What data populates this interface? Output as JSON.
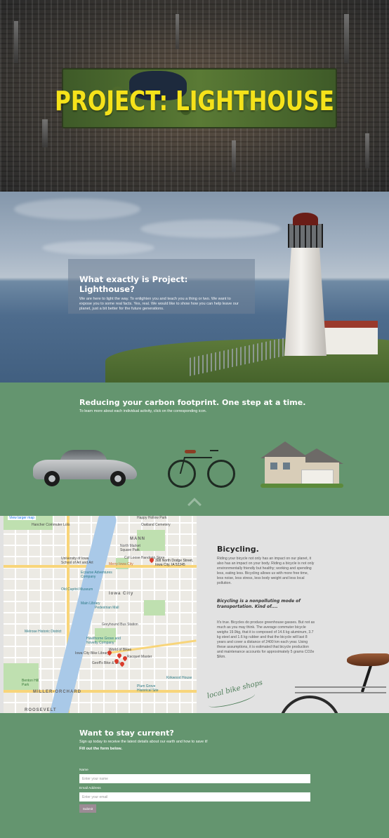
{
  "hero": {
    "title": "PROJECT: LIGHTHOUSE"
  },
  "intro": {
    "heading": "What exactly is Project: Lighthouse?",
    "text": "We are here to light the way. To enlighten you and teach you a thing or two. We want to expose you to some real facts. Yes, real. We would like to show how you can help leave our planet, just a bit better for the future generations."
  },
  "carbon": {
    "heading": "Reducing your carbon footprint. One step at a time.",
    "subtext": "To learn more about each individual activity, click on the corresponding icon.",
    "activities": [
      {
        "name": "car"
      },
      {
        "name": "bicycle"
      },
      {
        "name": "house"
      }
    ]
  },
  "map": {
    "view_link": "View larger map",
    "address": "308 North Dodge Street, Iowa City, IA 52245",
    "labels": {
      "happy_hollow": "Happy Hollow Park",
      "oakland": "Oakland Cemetery",
      "hancher": "Hancher Commuter Lots",
      "mann": "MANN",
      "north_market": "North Market Square Park",
      "col_loose": "Col Loose Handgrip Store",
      "merry_iowa": "Merry Iowa City",
      "univ_iowa": "University of Iowa School of Art and Art",
      "ecourse": "Ecourse Adventures Company",
      "old_capitol": "Old Capitol Museum",
      "iowa_city": "Iowa City",
      "main_library": "Main Library",
      "ped_mall": "Pedestrian Mall",
      "melrose": "Melrose Historic District",
      "greyhound": "Greyhound Bus Station",
      "hawthorne": "Hawthorne Grove and Novelty Company",
      "bike_library": "Iowa City Bike Library",
      "world_bikes": "World of Bikes",
      "racquet": "Racquet Master",
      "geoff": "Geoff's Bike & Ski",
      "kirkwood_house": "Kirkwood House",
      "plum_grove": "Plum Grove Historical Site",
      "miller_orchard": "MILLER-ORCHARD",
      "roosevelt": "ROOSEVELT",
      "benton_hill": "Benton Hill Park"
    }
  },
  "bicycling": {
    "heading": "Bicycling.",
    "paragraph1": "Riding your bicycle not only has an impact on our planet, it also has an impact on your body. Riding a bicycle is not only environmentally friendly but healthy; working and spending less, eating less. Bicycling allows us with more free time, less noise, less stress, less body weight and less local pollution.",
    "quote": "Bicycling is a nonpolluting mode of transportation. Kind of....",
    "paragraph2": "It's true. Bicycles do produce greenhouse gasses. But not as much as you may think. The average commuter bicycle weighs 19.9kg, that it is composed of 14.6 kg aluminum, 3.7 kg steel and 1.6 kg rubber and that the bicycle will last 8 years and cover a distance of 2400 km each year. Using these assumptions, it is estimated that bicycle production and maintenance accounts for approximately 5 grams CO2e $/km.",
    "shop_logo": "local bike shops"
  },
  "newsletter": {
    "heading": "Want to stay current?",
    "subtext": "Sign up today to receive the latest details about our earth and how to save it!",
    "fill_text": "Fill out the form below.",
    "name_label": "Name",
    "name_placeholder": "Enter your name",
    "email_label": "Email Address",
    "email_placeholder": "Enter your email",
    "submit_label": "Submit"
  },
  "colors": {
    "section_green": "#64956f",
    "title_yellow": "#f5e21a",
    "panel_gray": "#e2e2e2"
  }
}
